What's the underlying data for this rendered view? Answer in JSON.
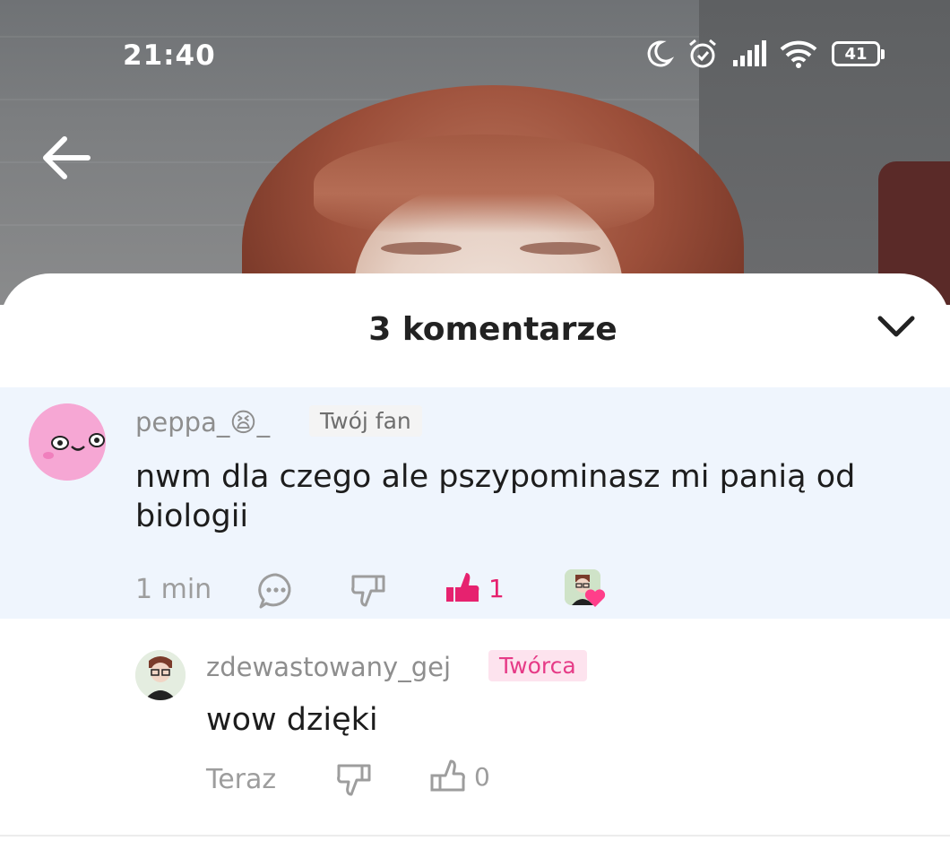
{
  "status_bar": {
    "time": "21:40",
    "battery": "41",
    "icons": [
      "moon-icon",
      "alarm-icon",
      "signal-icon",
      "wifi-icon",
      "battery-icon"
    ]
  },
  "header": {
    "back_icon": "arrow-left-icon"
  },
  "sheet": {
    "title": "3 komentarze",
    "collapse_icon": "chevron-down-icon"
  },
  "comments": [
    {
      "username": "peppa_😫_",
      "badge": "Twój fan",
      "text_line1": "nwm dla czego ale pszypominasz mi panią od",
      "text_line2": "biologii",
      "time": "1 min",
      "like_count": "1",
      "liked": true
    },
    {
      "username": "zdewastowany_gej",
      "badge": "Twórca",
      "text": "wow dzięki",
      "time": "Teraz",
      "like_count": "0",
      "liked": false
    }
  ],
  "colors": {
    "accent": "#e6226f",
    "highlight_bg": "#eff5fd",
    "creator_badge_bg": "#fde3ee",
    "creator_badge_text": "#e63b87"
  }
}
